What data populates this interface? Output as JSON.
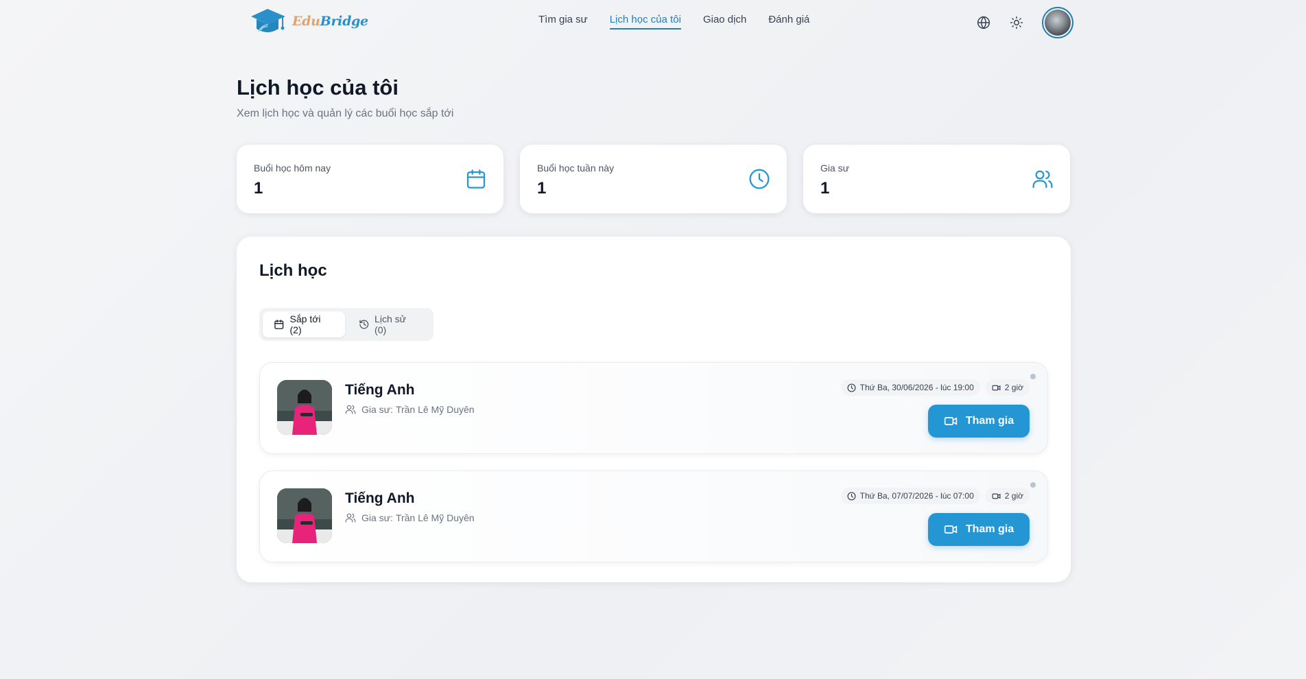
{
  "brand": {
    "part1": "Edu",
    "part2": "Bridge"
  },
  "nav": {
    "items": [
      {
        "label": "Tìm gia sư"
      },
      {
        "label": "Lịch học của tôi"
      },
      {
        "label": "Giao dịch"
      },
      {
        "label": "Đánh giá"
      }
    ],
    "active_index": 1
  },
  "header_icons": [
    "globe-icon",
    "sun-icon",
    "avatar"
  ],
  "page": {
    "title": "Lịch học của tôi",
    "subtitle": "Xem lịch học và quản lý các buổi học sắp tới"
  },
  "stats": [
    {
      "label": "Buổi học hôm nay",
      "value": "1",
      "icon": "calendar-icon"
    },
    {
      "label": "Buổi học tuần này",
      "value": "1",
      "icon": "clock-icon"
    },
    {
      "label": "Gia sư",
      "value": "1",
      "icon": "users-icon"
    }
  ],
  "schedule": {
    "title": "Lịch học",
    "tabs": [
      {
        "label": "Sắp tới (2)",
        "icon": "calendar-icon"
      },
      {
        "label": "Lịch sử (0)",
        "icon": "history-icon"
      }
    ],
    "active_tab": 0,
    "sessions": [
      {
        "subject": "Tiếng Anh",
        "tutor_prefix": "Gia sư:",
        "tutor_name": "Trần Lê Mỹ Duyên",
        "datetime": "Thứ Ba, 30/06/2026 - lúc 19:00",
        "duration": "2 giờ",
        "join_label": "Tham gia"
      },
      {
        "subject": "Tiếng Anh",
        "tutor_prefix": "Gia sư:",
        "tutor_name": "Trần Lê Mỹ Duyên",
        "datetime": "Thứ Ba, 07/07/2026 - lúc 07:00",
        "duration": "2 giờ",
        "join_label": "Tham gia"
      }
    ]
  },
  "colors": {
    "accent": "#2496d3",
    "nav_active": "#1f7fb6",
    "brand_edu": "#e0a36f",
    "brand_bridge": "#2b8fc9"
  }
}
